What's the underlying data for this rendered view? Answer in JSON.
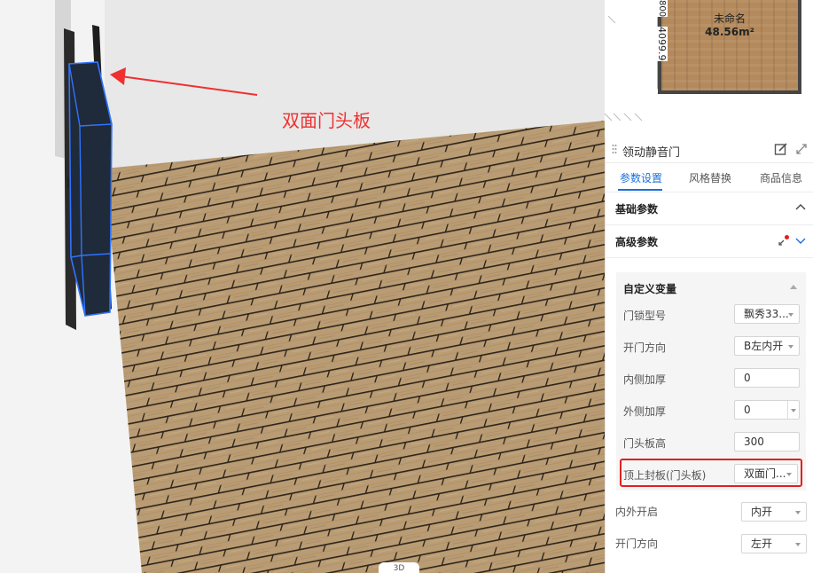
{
  "annotation": {
    "text": "双面门头板"
  },
  "viewport": {
    "bottom_tab": "3D"
  },
  "minimap": {
    "room_name": "未命名",
    "room_area": "48.56m²",
    "dim_main": "4099.9",
    "dim_small": "800"
  },
  "panel": {
    "title": "领动静音门",
    "tabs": [
      "参数设置",
      "风格替换",
      "商品信息"
    ],
    "sections": {
      "basic": "基础参数",
      "advanced": "高级参数"
    },
    "custom_group": {
      "title": "自定义变量"
    },
    "rows": [
      {
        "label": "门锁型号",
        "value": "飘秀33...",
        "kind": "select"
      },
      {
        "label": "开门方向",
        "value": "B左内开",
        "kind": "select"
      },
      {
        "label": "内侧加厚",
        "value": "0",
        "kind": "input"
      },
      {
        "label": "外侧加厚",
        "value": "0",
        "kind": "spin"
      },
      {
        "label": "门头板高",
        "value": "300",
        "kind": "input"
      },
      {
        "label": "顶上封板(门头板)",
        "value": "双面门...",
        "kind": "select"
      }
    ],
    "outer_rows": [
      {
        "label": "内外开启",
        "value": "内开"
      },
      {
        "label": "开门方向",
        "value": "左开"
      }
    ]
  },
  "colors": {
    "accent": "#1b6fd8",
    "highlight": "#e02020",
    "annotation": "#f03030",
    "floor": "#b89a72"
  }
}
